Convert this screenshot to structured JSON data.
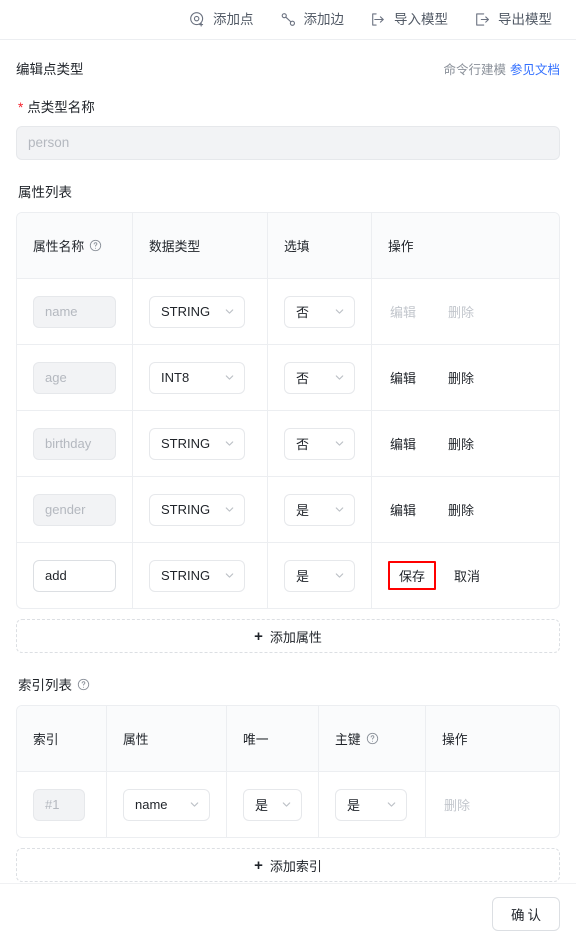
{
  "toolbar": {
    "items": [
      {
        "icon": "add-vertex-icon",
        "label": "添加点"
      },
      {
        "icon": "add-edge-icon",
        "label": "添加边"
      },
      {
        "icon": "import-model-icon",
        "label": "导入模型"
      },
      {
        "icon": "export-model-icon",
        "label": "导出模型"
      }
    ]
  },
  "header": {
    "title": "编辑点类型",
    "cli_text": "命令行建模",
    "doc_link": "参见文档"
  },
  "vertex_name_field": {
    "required_mark": "*",
    "label": "点类型名称",
    "value": "person",
    "placeholder": "person",
    "disabled": true
  },
  "attribute_section": {
    "title": "属性列表",
    "columns": [
      "属性名称",
      "数据类型",
      "选填",
      "操作"
    ],
    "name_help_tooltip": "help-icon",
    "rows": [
      {
        "name": "name",
        "data_type": "STRING",
        "nullable": "否",
        "actions": [
          {
            "label": "编辑",
            "state": "disabled"
          },
          {
            "label": "删除",
            "state": "disabled"
          }
        ]
      },
      {
        "name": "age",
        "data_type": "INT8",
        "nullable": "否",
        "actions": [
          {
            "label": "编辑",
            "state": "normal"
          },
          {
            "label": "删除",
            "state": "normal"
          }
        ]
      },
      {
        "name": "birthday",
        "data_type": "STRING",
        "nullable": "否",
        "actions": [
          {
            "label": "编辑",
            "state": "normal"
          },
          {
            "label": "删除",
            "state": "normal"
          }
        ]
      },
      {
        "name": "gender",
        "data_type": "STRING",
        "nullable": "是",
        "actions": [
          {
            "label": "编辑",
            "state": "normal"
          },
          {
            "label": "删除",
            "state": "normal"
          }
        ]
      },
      {
        "name": "add",
        "data_type": "STRING",
        "nullable": "是",
        "editing": true,
        "actions": [
          {
            "label": "保存",
            "state": "highlighted"
          },
          {
            "label": "取消",
            "state": "normal"
          }
        ]
      }
    ],
    "add_button": {
      "plus": "+",
      "label": "添加属性"
    }
  },
  "index_section": {
    "title": "索引列表",
    "title_help_tooltip": "help-icon",
    "columns": [
      "索引",
      "属性",
      "唯一",
      "主键",
      "操作"
    ],
    "primary_key_help_tooltip": "help-icon",
    "rows": [
      {
        "index": "#1",
        "attribute": "name",
        "unique": "是",
        "primary_key": "是",
        "actions": [
          {
            "label": "删除",
            "state": "disabled"
          }
        ]
      }
    ],
    "add_button": {
      "plus": "+",
      "label": "添加索引"
    }
  },
  "footer": {
    "confirm_label": "确认"
  },
  "colors": {
    "accent_link": "#3370ff",
    "required": "#f5222d",
    "highlight_box": "#ff0000",
    "text": "#1f2329",
    "muted_text": "#c2c6cc",
    "border": "#eceef1",
    "disabled_bg": "#f2f3f5"
  }
}
